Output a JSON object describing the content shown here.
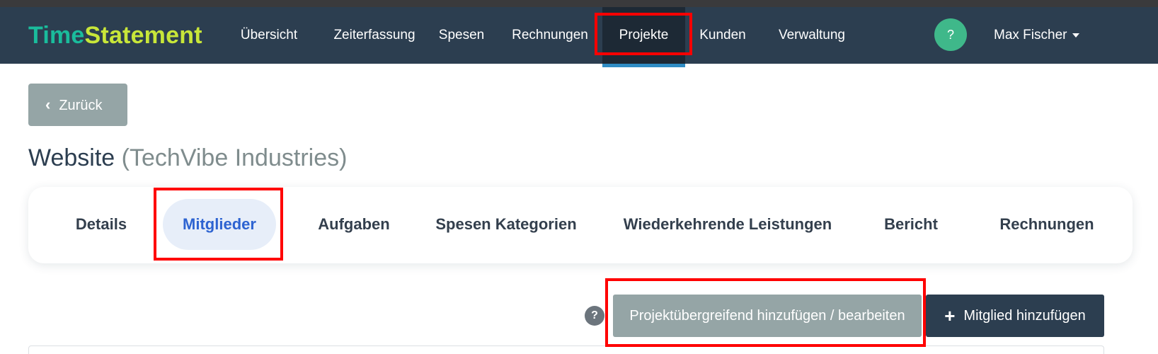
{
  "brand": {
    "part1": "Time",
    "part2": "Statement"
  },
  "nav": {
    "items": [
      {
        "label": "Übersicht"
      },
      {
        "label": "Zeiterfassung"
      },
      {
        "label": "Spesen"
      },
      {
        "label": "Rechnungen"
      },
      {
        "label": "Projekte",
        "active": true
      },
      {
        "label": "Kunden"
      },
      {
        "label": "Verwaltung"
      }
    ],
    "help_label": "?",
    "user_name": "Max Fischer"
  },
  "back_button": {
    "label": "Zurück"
  },
  "page": {
    "title": "Website",
    "subtitle": "(TechVibe Industries)"
  },
  "tabs": [
    {
      "label": "Details"
    },
    {
      "label": "Mitglieder",
      "active": true
    },
    {
      "label": "Aufgaben"
    },
    {
      "label": "Spesen Kategorien"
    },
    {
      "label": "Wiederkehrende Leistungen"
    },
    {
      "label": "Bericht"
    },
    {
      "label": "Rechnungen"
    }
  ],
  "actions": {
    "help_label": "?",
    "cross_project_label": "Projektübergreifend hinzufügen / bearbeiten",
    "add_member_label": "Mitglied hinzufügen"
  },
  "colors": {
    "navbar": "#2c3e50",
    "brand_time": "#1abc9c",
    "brand_statement": "#c8e639",
    "active_tab_text": "#2d63d1",
    "highlight_box": "#ff0000"
  }
}
